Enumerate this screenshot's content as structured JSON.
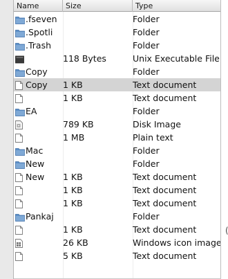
{
  "columns": {
    "name": "Name",
    "size": "Size",
    "kind": "Type"
  },
  "rows": [
    {
      "icon": "folder-icon",
      "name": ".fseven",
      "size": "",
      "kind": "Folder",
      "selected": false
    },
    {
      "icon": "folder-icon",
      "name": ".Spotli",
      "size": "",
      "kind": "Folder",
      "selected": false
    },
    {
      "icon": "folder-icon",
      "name": ".Trash",
      "size": "",
      "kind": "Folder",
      "selected": false
    },
    {
      "icon": "unix-executable-icon",
      "name": "",
      "size": "118 Bytes",
      "kind": "Unix Executable File",
      "selected": false
    },
    {
      "icon": "folder-icon",
      "name": "Copy",
      "size": "",
      "kind": "Folder",
      "selected": false
    },
    {
      "icon": "document-icon",
      "name": "Copy",
      "size": "1 KB",
      "kind": "Text document",
      "selected": true
    },
    {
      "icon": "document-icon",
      "name": "",
      "size": "1 KB",
      "kind": "Text document",
      "selected": false
    },
    {
      "icon": "folder-icon",
      "name": "EA",
      "size": "",
      "kind": "Folder",
      "selected": false
    },
    {
      "icon": "disk-image-icon",
      "name": "",
      "size": "789 KB",
      "kind": "Disk Image",
      "selected": false
    },
    {
      "icon": "document-icon",
      "name": "",
      "size": "1 MB",
      "kind": "Plain text",
      "selected": false
    },
    {
      "icon": "folder-icon",
      "name": "Mac",
      "size": "",
      "kind": "Folder",
      "selected": false
    },
    {
      "icon": "folder-icon",
      "name": "New",
      "size": "",
      "kind": "Folder",
      "selected": false
    },
    {
      "icon": "document-icon",
      "name": "New",
      "size": "1 KB",
      "kind": "Text document",
      "selected": false
    },
    {
      "icon": "document-icon",
      "name": "",
      "size": "1 KB",
      "kind": "Text document",
      "selected": false
    },
    {
      "icon": "document-icon",
      "name": "",
      "size": "1 KB",
      "kind": "Text document",
      "selected": false
    },
    {
      "icon": "folder-icon",
      "name": "Pankaj",
      "size": "",
      "kind": "Folder",
      "selected": false
    },
    {
      "icon": "document-icon",
      "name": "",
      "size": "1 KB",
      "kind": "Text document",
      "selected": false
    },
    {
      "icon": "windows-icon-image-icon",
      "name": "",
      "size": "26 KB",
      "kind": "Windows icon image",
      "selected": false
    },
    {
      "icon": "document-icon",
      "name": "",
      "size": "5 KB",
      "kind": "Text document",
      "selected": false
    }
  ],
  "stray_mark": "(",
  "colors": {
    "folder": "#5d90c8",
    "selection": "#d4d4d4",
    "header": "#e6e6e6"
  }
}
